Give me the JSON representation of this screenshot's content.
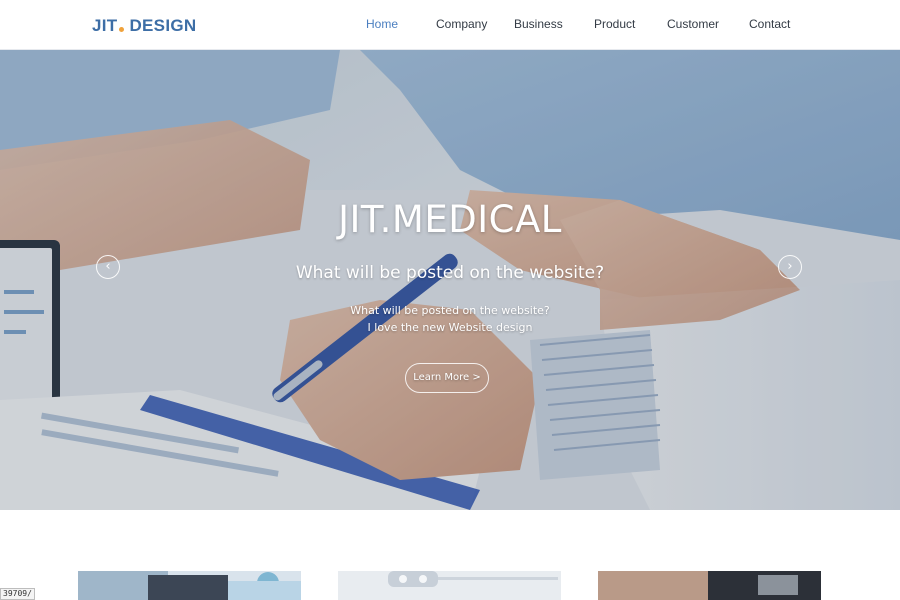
{
  "header": {
    "logo_left": "JIT",
    "logo_right": "DESIGN",
    "nav": [
      {
        "label": "Home",
        "active": true
      },
      {
        "label": "Company",
        "active": false
      },
      {
        "label": "Business",
        "active": false
      },
      {
        "label": "Product",
        "active": false
      },
      {
        "label": "Customer",
        "active": false
      },
      {
        "label": "Contact",
        "active": false
      }
    ]
  },
  "hero": {
    "title": "JIT.MEDICAL",
    "subtitle": "What will be posted on the website?",
    "desc_line1": "What will be posted on the website?",
    "desc_line2": "I love the new Website design",
    "button_label": "Learn More >",
    "prev_icon": "‹",
    "next_icon": "›"
  },
  "url_tag": "39709/",
  "colors": {
    "brand": "#3d6ea6",
    "logo_dot": "#f0a23b",
    "nav_active": "#4b7fc0",
    "nav_text": "#333b45"
  },
  "icons": {
    "prev": "chevron-left-icon",
    "next": "chevron-right-icon"
  }
}
